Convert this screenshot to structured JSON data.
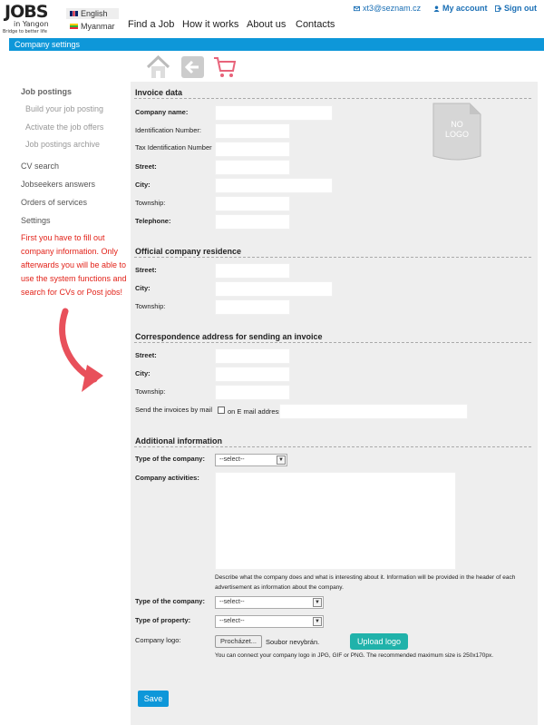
{
  "logo": {
    "brand": "JOBS",
    "city": "in Yangon",
    "tagline": "Bridge to better life"
  },
  "languages": [
    "English",
    "Myanmar"
  ],
  "nav": [
    "Find a Job",
    "How it works",
    "About us",
    "Contacts"
  ],
  "user": {
    "email": "xt3@seznam.cz",
    "account": "My account",
    "signout": "Sign out"
  },
  "section_bar": "Company settings",
  "sidebar": {
    "job_postings": "Job postings",
    "build": "Build your job posting",
    "activate": "Activate the job offers",
    "archive": "Job postings archive",
    "cv_search": "CV search",
    "answers": "Jobseekers answers",
    "orders": "Orders of services",
    "settings": "Settings",
    "warning": "First you have to fill out company information. Only afterwards you will be able to use the system functions and search for CVs or Post jobs!"
  },
  "invoice": {
    "title": "Invoice data",
    "company_name": "Company name:",
    "id_number": "Identification Number:",
    "tax_id": "Tax Identification Number",
    "street": "Street:",
    "city": "City:",
    "township": "Township:",
    "telephone": "Telephone:",
    "no_logo": "NO LOGO"
  },
  "residence": {
    "title": "Official company residence",
    "street": "Street:",
    "city": "City:",
    "township": "Township:"
  },
  "correspondence": {
    "title": "Correspondence address for sending an invoice",
    "street": "Street:",
    "city": "City:",
    "township": "Township:",
    "send_label": "Send the invoices by mail",
    "email_option": "on E mail address"
  },
  "additional": {
    "title": "Additional information",
    "type_company": "Type of the company:",
    "select_placeholder": "--select--",
    "activities": "Company activities:",
    "activities_note": "Describe what the company does and what is interesting about it. Information will be provided in the header of each advertisement as information about the company.",
    "type_company2": "Type of the company:",
    "type_property": "Type of property:",
    "logo_label": "Company logo:",
    "browse": "Procházet...",
    "no_file": "Soubor nevybrán.",
    "upload": "Upload logo",
    "logo_note": "You can connect your company logo in JPG, GIF or PNG. The recommended maximum size is 250x170px."
  },
  "save": "Save",
  "colors": {
    "accent": "#0e97d9",
    "warning": "#e2231a",
    "upload": "#20b2aa"
  }
}
